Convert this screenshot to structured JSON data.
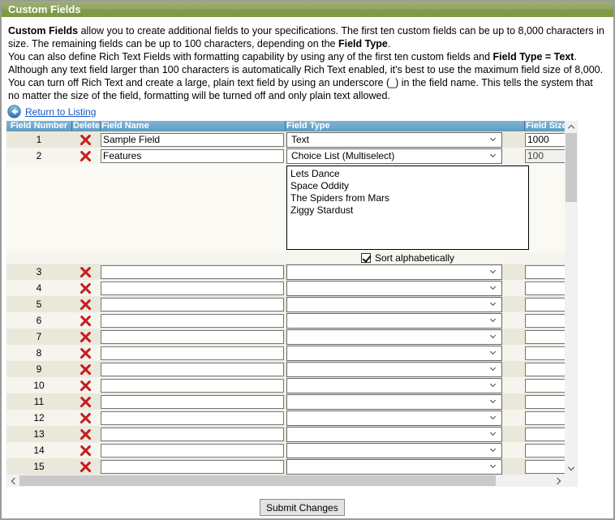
{
  "title": "Custom Fields",
  "intro": {
    "p1": {
      "s0": "Custom Fields",
      "s1": " allow you to create additional fields to your specifications. The first ten custom fields can be up to 8,000 characters in size. The remaining fields can be up to 100 characters, depending on the ",
      "s2": "Field Type",
      "s3": "."
    },
    "p2": {
      "s0": "You can also define Rich Text Fields with formatting capability by using any of the first ten custom fields and ",
      "s1": "Field Type = Text",
      "s2": ". Although any text field larger than 100 characters is automatically Rich Text enabled, it's best to use the maximum field size of 8,000."
    },
    "p3": {
      "s0": "You can turn off Rich Text and create a large, plain text field by using an underscore (_) in the field name. This tells the system that no matter the size of the field, formatting will be turned off and only plain text allowed."
    }
  },
  "return_link": {
    "label": "Return to Listing",
    "icon": "back-arrow-icon"
  },
  "table": {
    "headers": [
      "Field Number",
      "Delete",
      "Field Name",
      "Field Type",
      "Field Size"
    ],
    "delete_icon": "red-x-icon",
    "rows": [
      {
        "num": "1",
        "name": "Sample Field",
        "type": "Text",
        "size": "1000"
      },
      {
        "num": "2",
        "name": "Features",
        "type": "Choice List (Multiselect)",
        "size": "100",
        "size_readonly": true,
        "options": [
          "Lets Dance",
          "Space Oddity",
          "The Spiders from Mars",
          "Ziggy Stardust"
        ],
        "sort_checkbox": {
          "label": "Sort alphabetically",
          "checked": true
        }
      },
      {
        "num": "3",
        "name": "",
        "type": "",
        "size": ""
      },
      {
        "num": "4",
        "name": "",
        "type": "",
        "size": ""
      },
      {
        "num": "5",
        "name": "",
        "type": "",
        "size": ""
      },
      {
        "num": "6",
        "name": "",
        "type": "",
        "size": ""
      },
      {
        "num": "7",
        "name": "",
        "type": "",
        "size": ""
      },
      {
        "num": "8",
        "name": "",
        "type": "",
        "size": ""
      },
      {
        "num": "9",
        "name": "",
        "type": "",
        "size": ""
      },
      {
        "num": "10",
        "name": "",
        "type": "",
        "size": ""
      },
      {
        "num": "11",
        "name": "",
        "type": "",
        "size": ""
      },
      {
        "num": "12",
        "name": "",
        "type": "",
        "size": ""
      },
      {
        "num": "13",
        "name": "",
        "type": "",
        "size": ""
      },
      {
        "num": "14",
        "name": "",
        "type": "",
        "size": ""
      },
      {
        "num": "15",
        "name": "",
        "type": "",
        "size": ""
      }
    ]
  },
  "submit_button": "Submit Changes",
  "colors": {
    "titlebar_green_top": "#9dae74",
    "titlebar_green_bottom": "#7e9a44",
    "table_header_blue_top": "#82b4d6",
    "table_header_blue_bottom": "#5e9bc0",
    "link_blue": "#1556c4",
    "delete_red": "#c41e1e",
    "row_odd": "#eae8db",
    "row_even": "#f5f4ed",
    "scrollbar_track": "#f1f1f1",
    "scrollbar_thumb": "#c9c9c9"
  }
}
